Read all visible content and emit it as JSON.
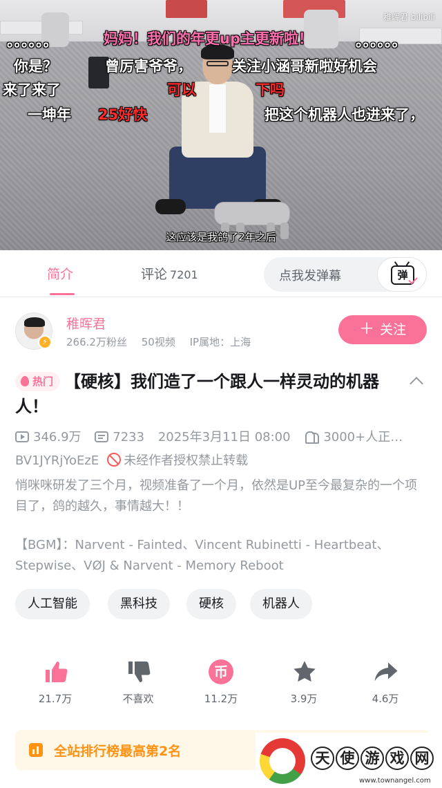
{
  "video": {
    "watermark": "稚晖君 bilibili",
    "subtitle": "这应该是我鸽了2年之后",
    "danmaku": [
      "。。。。。。",
      "妈妈！我们的年更up主更新啦！",
      "。。。。。。",
      "你是？",
      "曾厉害爷爷，",
      "关注小涵哥新啦好机会",
      "来了来了",
      "可以",
      "下吗",
      "一坤年",
      "25好快",
      "把这个机器人也进来了，"
    ]
  },
  "tabs": {
    "intro": "简介",
    "comments": "评论",
    "comments_count": "7201",
    "danmaku_placeholder": "点我发弹幕",
    "danmaku_button": "弹"
  },
  "uploader": {
    "name": "稚晖君",
    "fans": "266.2万粉丝",
    "videos": "50视频",
    "ip": "IP属地：上海",
    "follow_label": "关注",
    "verified_mark": "⚡"
  },
  "video_info": {
    "hot_badge": "热门",
    "title": "【硬核】我们造了一个跟人一样灵动的机器人！",
    "views": "346.9万",
    "danmaku_count": "7233",
    "date": "2025年3月11日 08:00",
    "watching": "3000+人正…",
    "bvid": "BV1JYRjYoEzE",
    "copyright": "未经作者授权禁止转载",
    "description": "悄咪咪研发了三个月，视频准备了一个月，依然是UP至今最复杂的一个项目了，鸽的越久，事情越大！！",
    "bgm": "【BGM】：Narvent - Fainted、Vincent Rubinetti - Heartbeat、Stepwise、VØJ & Narvent - Memory Reboot"
  },
  "tags": [
    "人工智能",
    "黑科技",
    "硬核",
    "机器人"
  ],
  "actions": [
    {
      "name": "like",
      "label": "21.7万",
      "color": "#fb7299"
    },
    {
      "name": "dislike",
      "label": "不喜欢",
      "color": "#61666d"
    },
    {
      "name": "coin",
      "label": "11.2万",
      "color": "#fb7299",
      "glyph": "币"
    },
    {
      "name": "favorite",
      "label": "3.9万",
      "color": "#61666d"
    },
    {
      "name": "share",
      "label": "4.6万",
      "color": "#61666d"
    }
  ],
  "ranking": {
    "text": "全站排行榜最高第2名"
  },
  "site_watermark": {
    "chars": [
      "天",
      "使",
      "游",
      "戏",
      "网"
    ],
    "url": "www.townangel.com"
  },
  "colors": {
    "accent": "#fb7299",
    "ranking": "#ff9212",
    "secondary_text": "#9499a0"
  }
}
